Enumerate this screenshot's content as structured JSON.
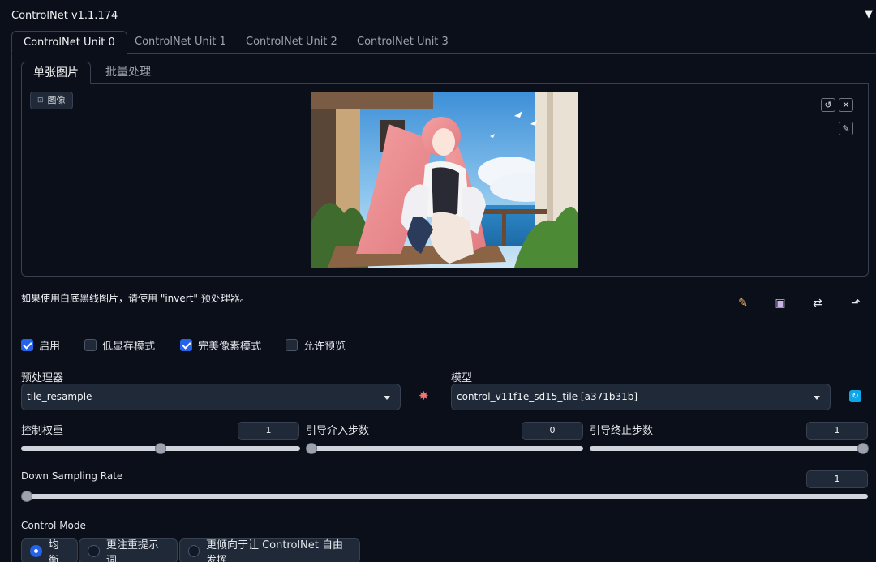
{
  "header": {
    "title": "ControlNet v1.1.174",
    "collapse_icon": "triangle-down-icon"
  },
  "unit_tabs": [
    {
      "label": "ControlNet Unit 0",
      "active": true
    },
    {
      "label": "ControlNet Unit 1",
      "active": false
    },
    {
      "label": "ControlNet Unit 2",
      "active": false
    },
    {
      "label": "ControlNet Unit 3",
      "active": false
    }
  ],
  "image_tabs": [
    {
      "label": "单张图片",
      "active": true
    },
    {
      "label": "批量处理",
      "active": false
    }
  ],
  "image_panel": {
    "label": "图像",
    "label_icon": "image-icon",
    "buttons": {
      "reset_icon": "undo-icon",
      "clear_icon": "close-icon",
      "edit_icon": "brush-icon"
    }
  },
  "hint": "如果使用白底黑线图片，请使用 \"invert\" 预处理器。",
  "toolbar_icons": [
    "new-canvas-icon",
    "camera-icon",
    "swap-icon",
    "send-dimensions-icon"
  ],
  "checkboxes": [
    {
      "label": "启用",
      "checked": true
    },
    {
      "label": "低显存模式",
      "checked": false
    },
    {
      "label": "完美像素模式",
      "checked": true
    },
    {
      "label": "允许预览",
      "checked": false
    }
  ],
  "preprocessor": {
    "label": "预处理器",
    "value": "tile_resample",
    "run_icon": "explosion-icon"
  },
  "model": {
    "label": "模型",
    "value": "control_v11f1e_sd15_tile [a371b31b]",
    "refresh_icon": "refresh-icon"
  },
  "sliders": {
    "weight": {
      "label": "控制权重",
      "value": "1",
      "min": 0,
      "max": 2,
      "current": 1
    },
    "guidance_start": {
      "label": "引导介入步数",
      "value": "0",
      "min": 0,
      "max": 1,
      "current": 0
    },
    "guidance_end": {
      "label": "引导终止步数",
      "value": "1",
      "min": 0,
      "max": 1,
      "current": 1
    },
    "down_sampling": {
      "label": "Down Sampling Rate",
      "value": "1",
      "min": 1,
      "max": 8,
      "current": 1
    }
  },
  "control_mode": {
    "label": "Control Mode",
    "options": [
      {
        "label": "均衡",
        "selected": true
      },
      {
        "label": "更注重提示词",
        "selected": false
      },
      {
        "label": "更倾向于让 ControlNet 自由发挥",
        "selected": false
      }
    ]
  },
  "colors": {
    "accent": "#2563eb",
    "background": "#0b0f19",
    "panel": "#1f2937",
    "border": "#374151"
  }
}
